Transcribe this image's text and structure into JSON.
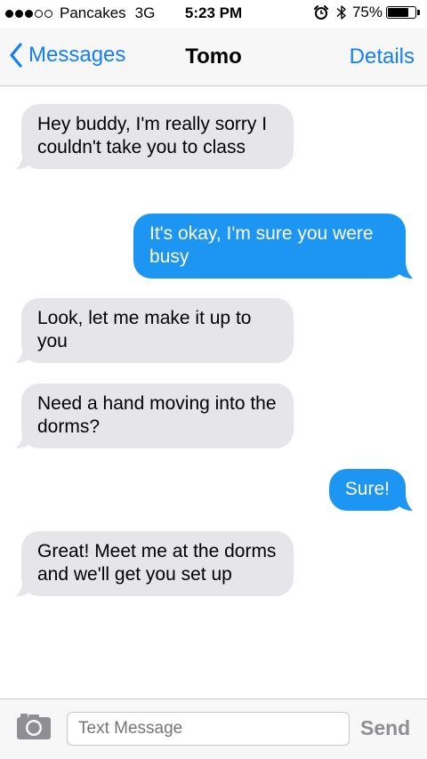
{
  "status_bar": {
    "signal_bars_filled": 3,
    "signal_bars_total": 5,
    "carrier": "Pancakes",
    "network": "3G",
    "time": "5:23 PM",
    "alarm_icon": "alarm-clock-icon",
    "bluetooth_icon": "bluetooth-icon",
    "battery_percent": "75%",
    "battery_level": 0.75
  },
  "nav": {
    "back_label": "Messages",
    "title": "Tomo",
    "details_label": "Details"
  },
  "messages": [
    {
      "direction": "incoming",
      "text": "Hey buddy, I'm really sorry I couldn't take you to class"
    },
    {
      "direction": "outgoing",
      "text": "It's okay, I'm sure you were busy"
    },
    {
      "direction": "incoming",
      "text": "Look, let me make it up to you"
    },
    {
      "direction": "incoming",
      "text": "Need a hand moving into the dorms?"
    },
    {
      "direction": "outgoing",
      "text": "Sure!"
    },
    {
      "direction": "incoming",
      "text": "Great! Meet me at the dorms and we'll get you set up"
    }
  ],
  "composer": {
    "camera_icon": "camera-icon",
    "placeholder": "Text Message",
    "send_label": "Send"
  },
  "colors": {
    "accent": "#157efb",
    "outgoing_bubble": "#1d96f3",
    "incoming_bubble": "#e5e5ea",
    "bar_background": "#f7f7f8",
    "send_disabled": "#8e8e93"
  }
}
